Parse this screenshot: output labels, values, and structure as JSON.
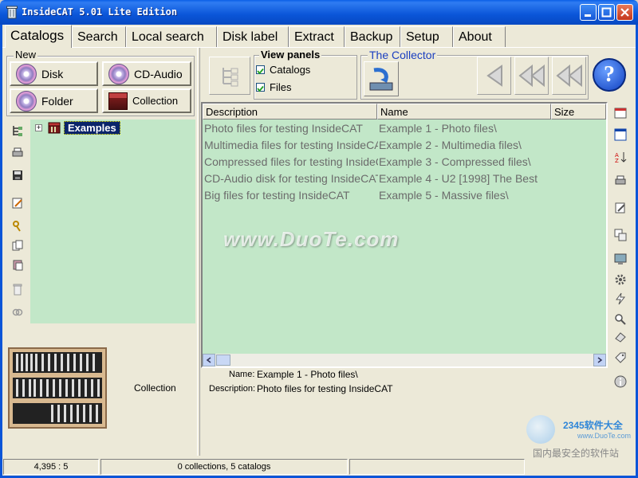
{
  "window": {
    "title": "InsideCAT 5.01 Lite Edition"
  },
  "tabs": [
    {
      "label": "Catalogs",
      "active": true
    },
    {
      "label": "Search"
    },
    {
      "label": "Local search"
    },
    {
      "label": "Disk label"
    },
    {
      "label": "Extract"
    },
    {
      "label": "Backup"
    },
    {
      "label": "Setup"
    },
    {
      "label": "About"
    }
  ],
  "new_group": {
    "legend": "New",
    "buttons": [
      {
        "label": "Disk",
        "icon": "disk-icon"
      },
      {
        "label": "CD-Audio",
        "icon": "cd-audio-icon"
      },
      {
        "label": "Folder",
        "icon": "folder-disk-icon"
      },
      {
        "label": "Collection",
        "icon": "collection-box-icon"
      }
    ]
  },
  "left_toolbar_icons": [
    "tree-icon",
    "print-icon",
    "save-icon",
    "edit-icon",
    "keys-icon",
    "copy-icon",
    "paste-icon",
    "delete-icon",
    "link-icon"
  ],
  "tree": {
    "items": [
      {
        "label": "Examples",
        "selected": true
      }
    ]
  },
  "collection_preview": {
    "label": "Collection"
  },
  "view_panels": {
    "legend": "View panels",
    "catalogs_label": "Catalogs",
    "catalogs_checked": true,
    "files_label": "Files",
    "files_checked": true
  },
  "collector": {
    "legend": "The Collector"
  },
  "list": {
    "columns": [
      "Description",
      "Name",
      "Size"
    ],
    "rows": [
      {
        "description": "Photo files for testing InsideCAT",
        "name": "Example 1 - Photo files\\"
      },
      {
        "description": "Multimedia files for testing InsideCAT",
        "name": "Example 2 - Multimedia files\\"
      },
      {
        "description": "Compressed files for testing InsideCAT",
        "name": "Example 3 - Compressed files\\"
      },
      {
        "description": "CD-Audio disk for testing InsideCAT",
        "name": "Example 4 - U2 [1998] The Best"
      },
      {
        "description": "Big files for testing InsideCAT",
        "name": "Example 5 - Massive files\\"
      }
    ]
  },
  "details": {
    "name_label": "Name:",
    "name_value": "Example 1 - Photo files\\",
    "description_label": "Description:",
    "description_value": "Photo files for testing InsideCAT"
  },
  "watermark": {
    "text": "www.DuoTe.com",
    "corner_lines": [
      "2345软件大全",
      "www.DuoTe.com",
      "国内最安全的软件站"
    ]
  },
  "status": {
    "left": "4,395 : 5",
    "middle": "0 collections, 5 catalogs"
  },
  "colors": {
    "title_blue": "#0a55d8",
    "panel_green": "#c2e7c8",
    "selection": "#0a246a",
    "collector_text": "#1a3ec0"
  }
}
